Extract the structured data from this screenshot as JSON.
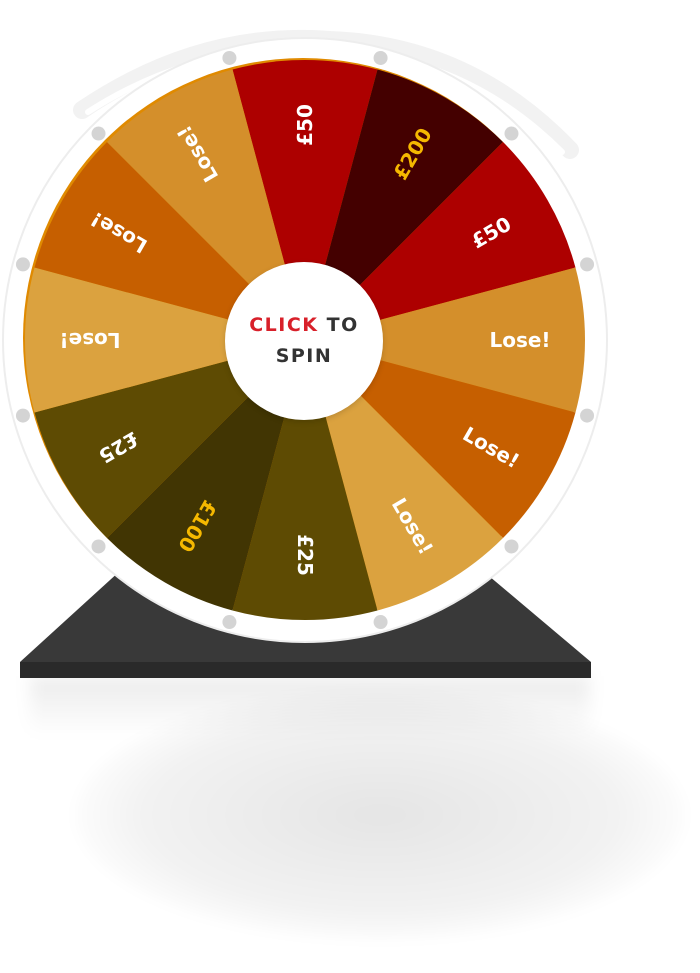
{
  "wheel": {
    "segments": [
      {
        "label": "£50",
        "color": "#ad0000",
        "text_color": "#ffffff"
      },
      {
        "label": "£200",
        "color": "#440000",
        "text_color": "#f5b800"
      },
      {
        "label": "£50",
        "color": "#ad0000",
        "text_color": "#ffffff"
      },
      {
        "label": "Lose!",
        "color": "#d48f2b",
        "text_color": "#ffffff"
      },
      {
        "label": "Lose!",
        "color": "#c65f00",
        "text_color": "#ffffff"
      },
      {
        "label": "Lose!",
        "color": "#dba23f",
        "text_color": "#ffffff"
      },
      {
        "label": "£25",
        "color": "#5e4b03",
        "text_color": "#ffffff"
      },
      {
        "label": "£100",
        "color": "#413503",
        "text_color": "#f5b800"
      },
      {
        "label": "£25",
        "color": "#5e4b03",
        "text_color": "#ffffff"
      },
      {
        "label": "Lose!",
        "color": "#dba23f",
        "text_color": "#ffffff"
      },
      {
        "label": "Lose!",
        "color": "#c65f00",
        "text_color": "#ffffff"
      },
      {
        "label": "Lose!",
        "color": "#d48f2b",
        "text_color": "#ffffff"
      }
    ]
  },
  "spin_button": {
    "click_word": "CLICK",
    "to_word": "TO",
    "spin_word": "SPIN"
  },
  "colors": {
    "rim": "#ffffff",
    "peg": "#d4d4d4",
    "stand": "#393939",
    "click_accent": "#d8202a"
  }
}
